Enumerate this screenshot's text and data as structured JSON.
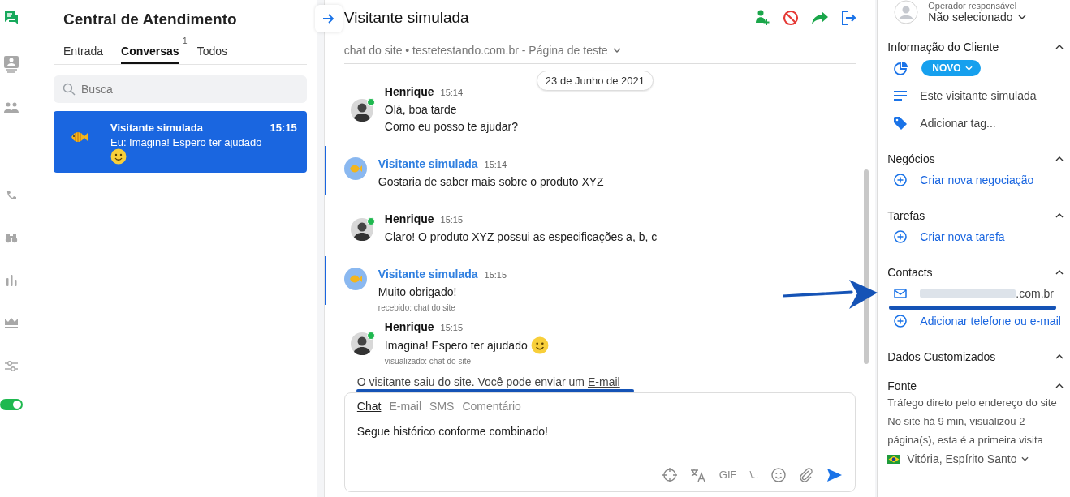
{
  "rail": {
    "items": [
      {
        "kind": "chat",
        "selected": true
      },
      {
        "kind": "contact",
        "selected": false
      },
      {
        "kind": "people",
        "selected": false
      },
      {
        "kind": "phone",
        "selected": false
      },
      {
        "kind": "binoculars",
        "selected": false
      },
      {
        "kind": "chart",
        "selected": false
      },
      {
        "kind": "crown",
        "selected": false
      },
      {
        "kind": "sliders",
        "selected": false
      }
    ],
    "toggle": {
      "on": true
    }
  },
  "inbox": {
    "title": "Central de Atendimento",
    "tabs": [
      {
        "label": "Entrada",
        "selected": false
      },
      {
        "label": "Conversas",
        "selected": true,
        "badge": "1"
      },
      {
        "label": "Todos",
        "selected": false
      }
    ],
    "search": {
      "placeholder": "Busca"
    },
    "conversations": [
      {
        "name": "Visitante simulada",
        "time": "15:15",
        "preview": "Eu: Imagina! Espero ter ajudado",
        "emoji": true,
        "selected": true
      }
    ]
  },
  "chat": {
    "title": "Visitante simulada",
    "source": "chat do site • testetestando.com.br - Página de teste",
    "date": "23 de Junho de 2021",
    "messages": [
      {
        "kind": "operator",
        "author": "Henrique",
        "time": "15:14",
        "online": true,
        "lines": [
          "Olá, boa tarde",
          "Como eu posso te ajudar?"
        ]
      },
      {
        "kind": "visitor",
        "author": "Visitante simulada",
        "time": "15:14",
        "lines": [
          "Gostaria de saber mais sobre o produto XYZ"
        ]
      },
      {
        "kind": "operator",
        "author": "Henrique",
        "time": "15:15",
        "online": true,
        "lines": [
          "Claro! O produto XYZ possui as especificações a, b, c"
        ]
      },
      {
        "kind": "visitor",
        "author": "Visitante simulada",
        "time": "15:15",
        "lines": [
          "Muito obrigado!"
        ],
        "receipt": "recebido: chat do site"
      },
      {
        "kind": "operator",
        "author": "Henrique",
        "time": "15:15",
        "online": true,
        "lines": [
          "Imagina! Espero ter ajudado"
        ],
        "emoji": true,
        "receipt": "visualizado: chat do site"
      }
    ],
    "notice": {
      "text": "O visitante saiu do site. Você pode enviar um",
      "link": "E-mail"
    },
    "composer": {
      "tabs": [
        {
          "label": "Chat",
          "selected": true
        },
        {
          "label": "E-mail",
          "selected": false
        },
        {
          "label": "SMS",
          "selected": false
        },
        {
          "label": "Comentário",
          "selected": false
        }
      ],
      "value": "Segue histórico conforme combinado!",
      "gif": "GIF",
      "snippet": "\\.."
    }
  },
  "details": {
    "operator": {
      "label": "Operador responsável",
      "value": "Não selecionado"
    },
    "sections": [
      {
        "title": "Informação do Cliente",
        "expanded": true,
        "rows": [
          {
            "kind": "status",
            "text": "NOVO"
          },
          {
            "kind": "note",
            "text": "Este visitante simulada"
          },
          {
            "kind": "tag",
            "text": "Adicionar tag..."
          }
        ]
      },
      {
        "title": "Negócios",
        "expanded": true,
        "rows": [
          {
            "kind": "add",
            "text": "Criar nova negociação"
          }
        ]
      },
      {
        "title": "Tarefas",
        "expanded": true,
        "rows": [
          {
            "kind": "add",
            "text": "Criar nova tarefa"
          }
        ]
      },
      {
        "title": "Contacts",
        "expanded": true,
        "rows": [
          {
            "kind": "email",
            "text": ".com.br"
          },
          {
            "kind": "add",
            "text": "Adicionar telefone ou e-mail"
          }
        ]
      },
      {
        "title": "Dados Customizados",
        "expanded": true
      },
      {
        "title": "Fonte",
        "expanded": true,
        "rows": [
          {
            "kind": "text",
            "text": "Tráfego direto pelo endereço do site"
          },
          {
            "kind": "text",
            "text": "No site há 9 min, visualizou 2 página(s), esta é a primeira visita"
          },
          {
            "kind": "location",
            "text": "Vitória, Espírito Santo"
          }
        ]
      }
    ]
  }
}
